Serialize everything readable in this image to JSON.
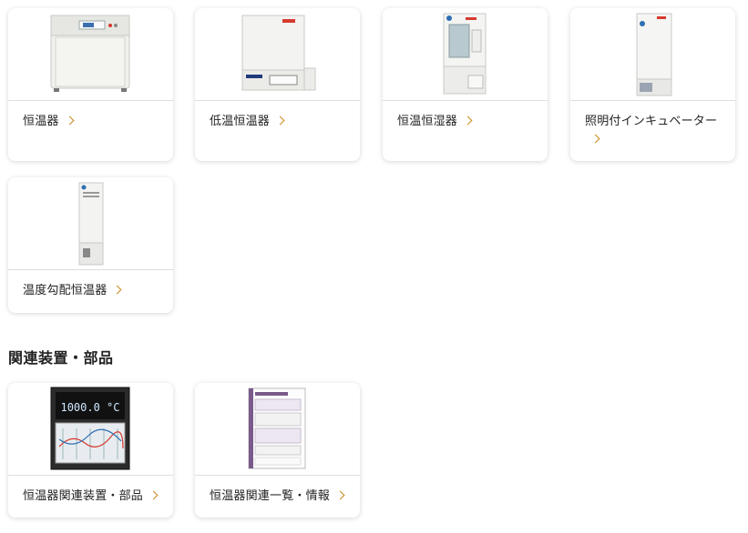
{
  "products": [
    {
      "label": "恒温器",
      "icon": "incubator-image"
    },
    {
      "label": "低温恒温器",
      "icon": "low-temperature-incubator-image"
    },
    {
      "label": "恒温恒湿器",
      "icon": "humidity-incubator-image"
    },
    {
      "label": "照明付インキュベーター",
      "icon": "illuminated-incubator-image"
    },
    {
      "label": "温度勾配恒温器",
      "icon": "gradient-incubator-image"
    }
  ],
  "related_section": {
    "title": "関連装置・部品",
    "items": [
      {
        "label": "恒温器関連装置・部品",
        "icon": "chart-recorder-image"
      },
      {
        "label": "恒温器関連一覧・情報",
        "icon": "spec-document-image"
      }
    ],
    "recorder_display": "1000.0 °C"
  },
  "colors": {
    "accent": "#c98a1a",
    "brand_red": "#d63a2f"
  }
}
